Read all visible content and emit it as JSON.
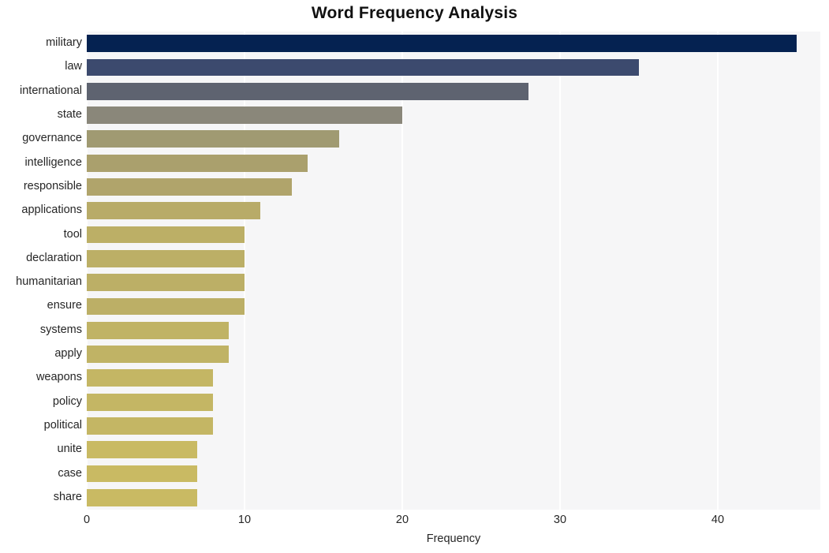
{
  "chart_data": {
    "type": "bar",
    "orientation": "horizontal",
    "title": "Word Frequency Analysis",
    "xlabel": "Frequency",
    "ylabel": "",
    "categories": [
      "military",
      "law",
      "international",
      "state",
      "governance",
      "intelligence",
      "responsible",
      "applications",
      "tool",
      "declaration",
      "humanitarian",
      "ensure",
      "systems",
      "apply",
      "weapons",
      "policy",
      "political",
      "unite",
      "case",
      "share"
    ],
    "values": [
      45,
      35,
      28,
      20,
      16,
      14,
      13,
      11,
      10,
      10,
      10,
      10,
      9,
      9,
      8,
      8,
      8,
      7,
      7,
      7
    ],
    "bar_colors": [
      "#052251",
      "#3c4a6e",
      "#5e6370",
      "#8a877a",
      "#a09a72",
      "#aaa06d",
      "#b0a46b",
      "#b8ab68",
      "#bcaf66",
      "#bcaf66",
      "#bcaf66",
      "#bcaf66",
      "#c0b365",
      "#c0b365",
      "#c4b664",
      "#c4b664",
      "#c4b664",
      "#c9ba63",
      "#c9ba63",
      "#c9ba63"
    ],
    "xlim": [
      0,
      46.5
    ],
    "xticks": [
      0,
      10,
      20,
      30,
      40
    ],
    "xtick_labels": [
      "0",
      "10",
      "20",
      "30",
      "40"
    ],
    "grid": "vertical",
    "grid_color": "#ffffff",
    "plot_background": "#f6f6f7",
    "figure_background": "#ffffff",
    "legend": "none"
  }
}
